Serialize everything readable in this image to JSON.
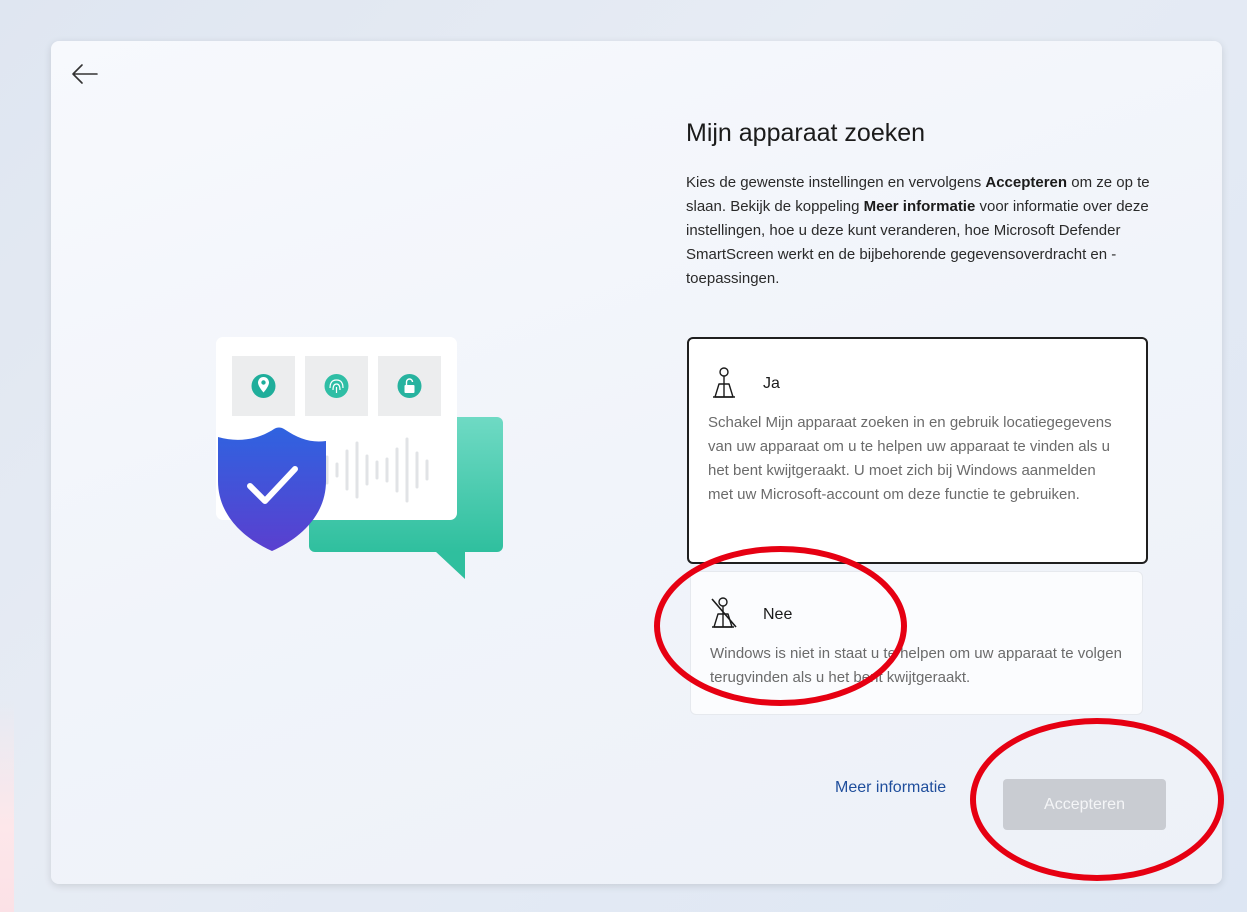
{
  "page": {
    "title": "Mijn apparaat zoeken",
    "description_parts": {
      "p1": "Kies de gewenste instellingen en vervolgens ",
      "b1": "Accepteren",
      "p2": " om ze op te slaan. Bekijk de koppeling ",
      "b2": "Meer informatie",
      "p3": " voor informatie over deze instellingen, hoe u deze kunt veranderen, hoe Microsoft Defender SmartScreen werkt en de bijbehorende gegevensoverdracht en -toepassingen."
    }
  },
  "options": {
    "yes": {
      "label": "Ja",
      "icon": "location-person-icon",
      "description": "Schakel Mijn apparaat zoeken in en gebruik locatiegegevens van uw apparaat om u te helpen uw apparaat te vinden als u het bent kwijtgeraakt. U moet zich bij Windows aanmelden met uw Microsoft-account om deze functie te gebruiken.",
      "selected": true
    },
    "no": {
      "label": "Nee",
      "icon": "location-off-icon",
      "description": "Windows is niet in staat u te helpen om uw apparaat te volgen terugvinden als u het bent kwijtgeraakt.",
      "selected": false
    }
  },
  "footer": {
    "more_info": "Meer informatie",
    "accept": "Accepteren"
  },
  "colors": {
    "link": "#1f4e9c",
    "annotation": "#e60012",
    "shield": "#3a5bd6",
    "chat_bubble": "#3cc9a6"
  }
}
